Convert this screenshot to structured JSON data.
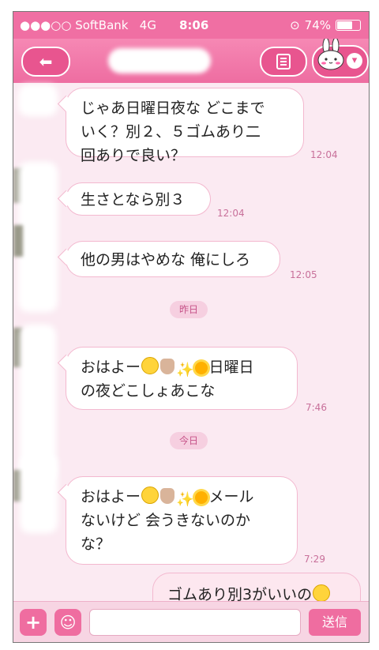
{
  "status": {
    "carrier": "●●●○○ SoftBank",
    "network": "4G",
    "time": "8:06",
    "battery": "74%",
    "battery_level": 0.74
  },
  "header": {
    "back_icon": "back-arrow-icon",
    "menu_icon": "menu-icon",
    "profile_icon": "bunny-sticker-icon"
  },
  "messages": [
    {
      "lines": "じゃあ日曜日夜な どこまで\nいく？別２、５ゴムあり二\n回ありで良い？",
      "time": "12:04"
    },
    {
      "lines": "生さとなら別３",
      "time": "12:04"
    },
    {
      "lines": "他の男はやめな 俺にしろ",
      "time": "12:05"
    },
    {
      "date": "昨日"
    },
    {
      "line1_pre": "おはよー",
      "line1_post": "日曜日",
      "line2": "の夜どこしょあこな",
      "time": "7:46"
    },
    {
      "date": "今日"
    },
    {
      "line1_pre": "おはよー",
      "line1_post": "メール",
      "line2": "ないけど 会うきないのか",
      "line3": "な？",
      "time": "7:29"
    },
    {
      "lines": "ゴムあり別3がいいの"
    }
  ],
  "inputbar": {
    "plus_icon": "plus-icon",
    "sticker_icon": "sticker-icon",
    "send_label": "送信",
    "placeholder": ""
  },
  "colors": {
    "accent": "#ef6da0",
    "background": "#fbeaf2"
  }
}
